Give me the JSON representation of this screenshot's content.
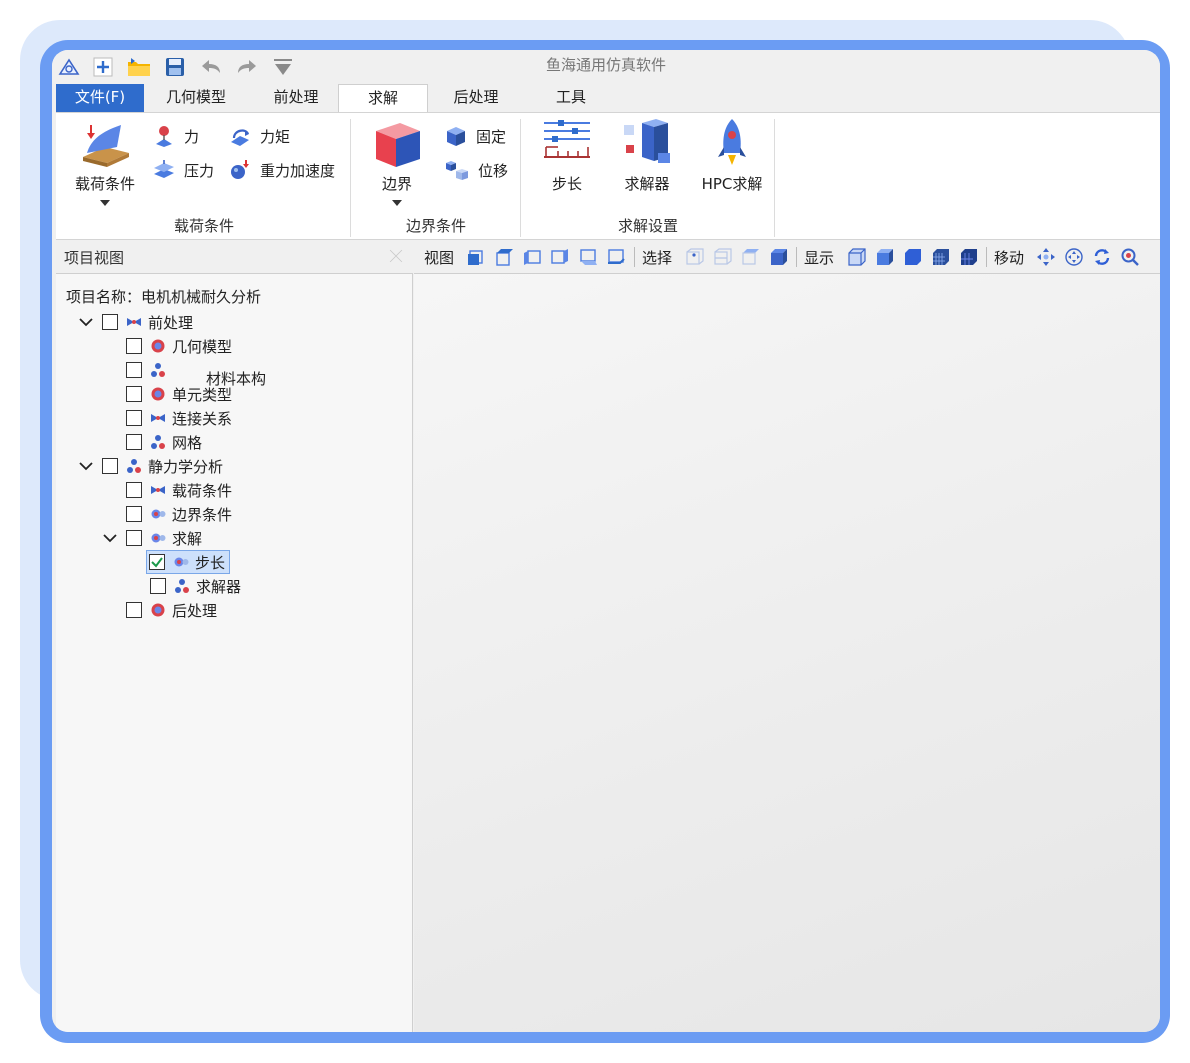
{
  "app": {
    "title": "鱼海通用仿真软件"
  },
  "colors": {
    "accent": "#2f6ccc",
    "frame": "#6b9cf3",
    "icon_blue": "#4a7be0"
  },
  "quick_access": [
    "home-icon",
    "new-icon",
    "open-folder-icon",
    "save-icon",
    "undo-icon",
    "redo-icon",
    "filter-icon"
  ],
  "tabs": [
    {
      "label": "文件(F)"
    },
    {
      "label": "几何模型"
    },
    {
      "label": "前处理"
    },
    {
      "label": "求解",
      "active": true
    },
    {
      "label": "后处理"
    },
    {
      "label": "工具"
    }
  ],
  "ribbon": {
    "load": {
      "group_label": "载荷条件",
      "big_label": "载荷条件",
      "items": [
        {
          "label": "力"
        },
        {
          "label": "力矩"
        },
        {
          "label": "压力"
        },
        {
          "label": "重力加速度"
        }
      ]
    },
    "boundary": {
      "group_label": "边界条件",
      "big_label": "边界",
      "items": [
        {
          "label": "固定"
        },
        {
          "label": "位移"
        }
      ]
    },
    "solve": {
      "group_label": "求解设置",
      "items": [
        {
          "label": "步长"
        },
        {
          "label": "求解器"
        },
        {
          "label": "HPC求解"
        }
      ]
    }
  },
  "project_panel": {
    "title": "项目视图",
    "project_name": "项目名称：电机机械耐久分析",
    "tree": {
      "pre": {
        "label": "前处理"
      },
      "geometry": {
        "label": "几何模型"
      },
      "material": {
        "label": "材料本构"
      },
      "element": {
        "label": "单元类型"
      },
      "connection": {
        "label": "连接关系"
      },
      "mesh": {
        "label": "网格"
      },
      "static": {
        "label": "静力学分析"
      },
      "load": {
        "label": "载荷条件"
      },
      "boundary": {
        "label": "边界条件"
      },
      "solve": {
        "label": "求解"
      },
      "step": {
        "label": "步长",
        "checked": true
      },
      "solver": {
        "label": "求解器"
      },
      "post": {
        "label": "后处理"
      }
    }
  },
  "view_toolbar": {
    "view_label": "视图",
    "select_label": "选择",
    "display_label": "显示",
    "move_label": "移动"
  }
}
